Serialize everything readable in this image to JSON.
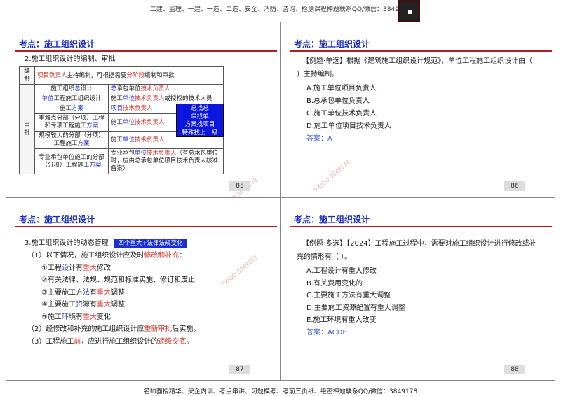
{
  "header": {
    "banner": "二建、监理、一建、一造、二造、安全、消防、咨询、检测课程押题联系QQ/微信：3849178"
  },
  "footer": {
    "banner": "名师面授精华、央企内训、考点串讲、习题模考、考前三页纸、绝密押题联系QQ/微信：3849178"
  },
  "watermark": "VX/QQ:3849178",
  "colors": {
    "red": "#e0302a",
    "blue": "#2a35d0",
    "title": "#1a2fc0"
  },
  "slides": [
    {
      "title": "考点：施工组织设计",
      "page": "85",
      "subtitle": "2.施工组织设计的编制、审批",
      "table": {
        "row_bianzhi": {
          "label": "编制",
          "content": [
            [
              "项目负责人",
              "r"
            ],
            [
              "主持编制，可根据需要",
              ""
            ],
            [
              "分阶段",
              "r"
            ],
            [
              "编制和审批",
              ""
            ]
          ]
        },
        "shenpi_label": "审批",
        "rows": [
          {
            "left": [
              [
                "施工组织",
                ""
              ],
              [
                "总",
                "b"
              ],
              [
                "设计",
                ""
              ]
            ],
            "right": [
              [
                "总",
                "b"
              ],
              [
                "承包单位",
                ""
              ],
              [
                "技术负责人",
                "r"
              ]
            ]
          },
          {
            "left": [
              [
                "单位",
                "b"
              ],
              [
                "工程施工组织设计",
                ""
              ]
            ],
            "right": [
              [
                "施工",
                ""
              ],
              [
                "单位",
                "b"
              ],
              [
                "技术负责人",
                "r"
              ],
              [
                "或授权的技术人员",
                ""
              ]
            ]
          },
          {
            "left": [
              [
                "施工",
                ""
              ],
              [
                "方案",
                "b"
              ]
            ],
            "right": [
              [
                "项目",
                "b"
              ],
              [
                "技术负责人",
                "r"
              ]
            ]
          },
          {
            "left": [
              [
                "重难点分部（分项）工程和专项工程施工",
                ""
              ],
              [
                "方案",
                "b"
              ]
            ],
            "right": [
              [
                "施工",
                ""
              ],
              [
                "单位",
                "b"
              ],
              [
                "技术负责人",
                "r"
              ]
            ]
          },
          {
            "left": [
              [
                "规模较大的分部（分项）工程施工",
                ""
              ],
              [
                "方案",
                "b"
              ]
            ],
            "right": [
              [
                "施工",
                ""
              ],
              [
                "单位",
                "b"
              ],
              [
                "技术负责人",
                "r"
              ]
            ]
          },
          {
            "left": [
              [
                "专业承包单位施工的分部（分项）工程施工",
                ""
              ],
              [
                "方案",
                "b"
              ]
            ],
            "right": [
              [
                "专业承包",
                ""
              ],
              [
                "单位",
                "b"
              ],
              [
                "技术负责人",
                "r"
              ],
              [
                "（有总承包单位时，应由总承包单位项目技术负责人核准备案）",
                ""
              ]
            ]
          }
        ]
      },
      "callout": [
        "总找总",
        "单找单",
        "方案找项目",
        "特殊找上一级"
      ]
    },
    {
      "title": "考点：施工组织设计",
      "page": "86",
      "question": "【例题·单选】根据《建筑施工组织设计规范》，单位工程施工组织设计由（ ）主持编制。",
      "options": [
        "A.施工单位项目负责人",
        "B.总承包单位负责人",
        "C.施工单位技术负责人",
        "D.施工单位项目技术负责人"
      ],
      "answer": "答案：A"
    },
    {
      "title": "考点：施工组织设计",
      "page": "87",
      "heading": "3.施工组织设计的动态管理",
      "tag": "四个重大+法律法规变化",
      "lines": [
        [
          [
            "（1）以下情况，施工组织设计应及时",
            ""
          ],
          [
            "修改和补充",
            "r"
          ],
          [
            "：",
            ""
          ]
        ],
        [
          [
            "①工程",
            ""
          ],
          [
            "设",
            "b"
          ],
          [
            "计有",
            ""
          ],
          [
            "重大",
            "r"
          ],
          [
            "修改",
            ""
          ]
        ],
        [
          [
            "②有关法律、法规、规范和标准实施、修订和废止",
            ""
          ]
        ],
        [
          [
            "③主要施工方",
            ""
          ],
          [
            "法",
            "b"
          ],
          [
            "有",
            ""
          ],
          [
            "重大",
            "r"
          ],
          [
            "调整",
            ""
          ]
        ],
        [
          [
            "④主要施工",
            ""
          ],
          [
            "资",
            "b"
          ],
          [
            "源有",
            ""
          ],
          [
            "重大",
            "r"
          ],
          [
            "调整",
            ""
          ]
        ],
        [
          [
            "⑤施工",
            ""
          ],
          [
            "环",
            "b"
          ],
          [
            "境有",
            ""
          ],
          [
            "重大",
            "r"
          ],
          [
            "变化",
            ""
          ]
        ],
        [
          [
            "（2）经修改和补充的施工组织设计应",
            ""
          ],
          [
            "重新审批",
            "r"
          ],
          [
            "后实施。",
            ""
          ]
        ],
        [
          [
            "（3）工程施工",
            ""
          ],
          [
            "前",
            "r"
          ],
          [
            "，应进行施工组织设计的",
            ""
          ],
          [
            "逐级交底",
            "r"
          ],
          [
            "。",
            ""
          ]
        ]
      ]
    },
    {
      "title": "考点：施工组织设计",
      "page": "88",
      "question": "【例题·多选】【2024】工程施工过程中，需要对施工组织设计进行修改或补充的情形有（ ）。",
      "options": [
        "A.工程设计有重大修改",
        "B.有关费用变化的",
        "C.主要施工方法有重大调整",
        "D.主要施工资源配置有重大调整",
        "E.施工环境有重大改变"
      ],
      "answer": "答案：ACDE"
    }
  ]
}
